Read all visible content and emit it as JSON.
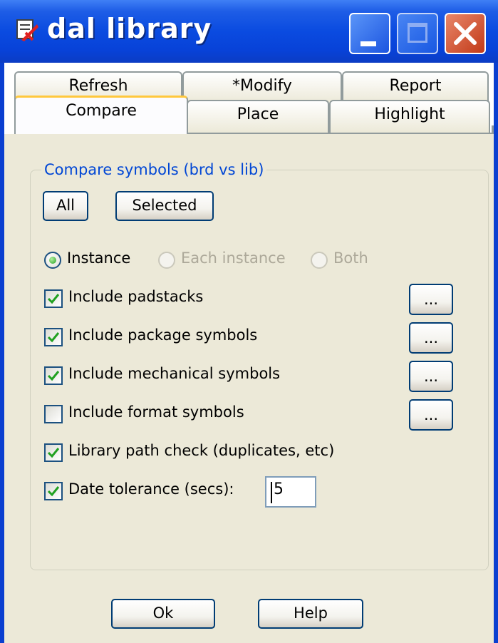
{
  "window": {
    "title": "dal library"
  },
  "tabs": {
    "row1": [
      "Refresh",
      "*Modify",
      "Report"
    ],
    "row2": [
      "Compare",
      "Place",
      "Highlight"
    ],
    "active": "Compare"
  },
  "group": {
    "legend": "Compare symbols (brd vs lib)",
    "all_label": "All",
    "selected_label": "Selected"
  },
  "mode": {
    "instance_label": "Instance",
    "each_instance_label": "Each instance",
    "both_label": "Both",
    "selected": "Instance"
  },
  "options": [
    {
      "label": "Include padstacks",
      "checked": true,
      "browse_label": "..."
    },
    {
      "label": "Include package symbols",
      "checked": true,
      "browse_label": "..."
    },
    {
      "label": "Include mechanical symbols",
      "checked": true,
      "browse_label": "..."
    },
    {
      "label": "Include format symbols",
      "checked": false,
      "browse_label": "..."
    },
    {
      "label": "Library path check (duplicates, etc)",
      "checked": true
    },
    {
      "label": "Date tolerance (secs):",
      "checked": true
    }
  ],
  "date_tolerance": {
    "value": "5"
  },
  "footer": {
    "ok_label": "Ok",
    "help_label": "Help"
  },
  "colors": {
    "titlebar": "#0a4be0",
    "face": "#ece9d8",
    "legend": "#0046d5",
    "active_tab_highlight": "#ffc83c"
  }
}
